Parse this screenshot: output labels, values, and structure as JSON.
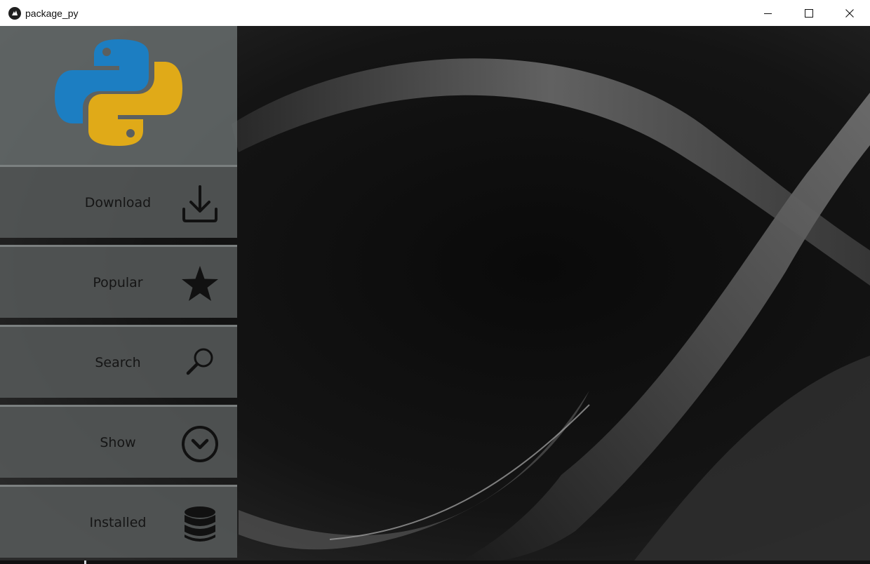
{
  "window": {
    "title": "package_py",
    "app_icon": "kivy-icon",
    "controls": [
      "minimize-icon",
      "maximize-icon",
      "close-icon"
    ]
  },
  "sidebar": {
    "logo": "python-logo",
    "items": [
      {
        "label": "Download",
        "icon": "download-icon"
      },
      {
        "label": "Popular",
        "icon": "star-icon"
      },
      {
        "label": "Search",
        "icon": "search-icon"
      },
      {
        "label": "Show",
        "icon": "chevron-down-circle-icon"
      },
      {
        "label": "Installed",
        "icon": "database-icon"
      }
    ]
  },
  "colors": {
    "python_blue": "#1c7ec2",
    "python_yellow": "#e0aa18",
    "panel": "#5b5f5f",
    "background": "#000000"
  }
}
